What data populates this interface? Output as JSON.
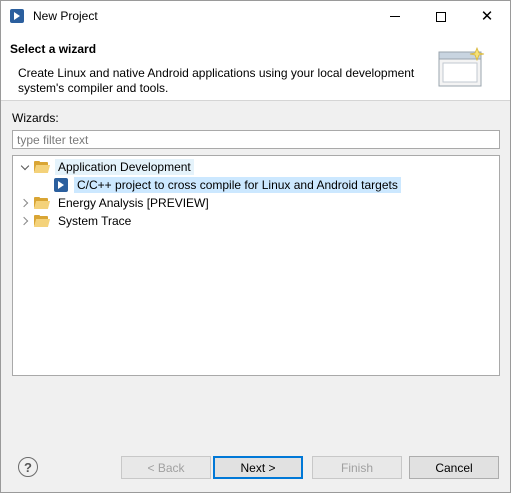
{
  "window": {
    "title": "New Project"
  },
  "banner": {
    "heading": "Select a wizard",
    "description": "Create Linux and native Android applications using your local development system's compiler and tools."
  },
  "wizards": {
    "label": "Wizards:",
    "filter_placeholder": "type filter text",
    "filter_value": ""
  },
  "tree": {
    "items": [
      {
        "label": "Application Development",
        "expanded": true,
        "icon": "folder-open-icon"
      },
      {
        "label": "C/C++ project to cross compile for Linux and Android targets",
        "selected": true,
        "icon": "project-icon"
      },
      {
        "label": "Energy Analysis [PREVIEW]",
        "expanded": false,
        "icon": "folder-icon"
      },
      {
        "label": "System Trace",
        "expanded": false,
        "icon": "folder-icon"
      }
    ]
  },
  "buttons": {
    "help": "?",
    "back": "< Back",
    "next": "Next >",
    "finish": "Finish",
    "cancel": "Cancel"
  },
  "colors": {
    "accent": "#0078d7",
    "selection": "#cce8ff",
    "app_icon": "#2b5f9e"
  }
}
